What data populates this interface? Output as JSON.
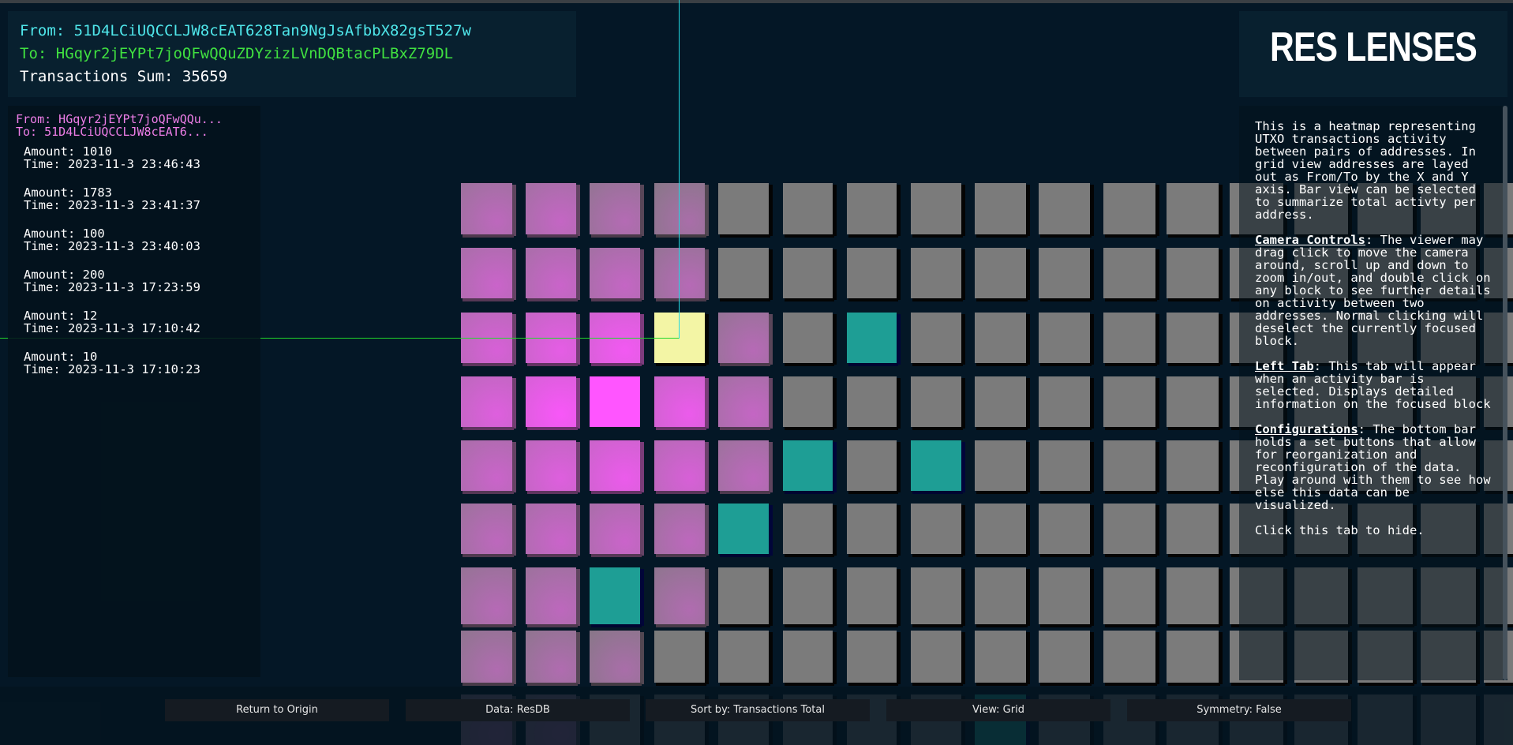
{
  "header": {
    "from_label": "From:",
    "from_address": "51D4LCiUQCCLJW8cEAT628Tan9NgJsAfbbX82gsT527w",
    "to_label": "To:",
    "to_address": "HGqyr2jEYPt7joQFwQQuZDYzizLVnDQBtacPLBxZ79DL",
    "sum_label": "Transactions Sum:",
    "sum_value": "35659"
  },
  "logo": {
    "text": "RES LENSES"
  },
  "left_tab": {
    "from_text": "From: HGqyr2jEYPt7joQFwQQu...",
    "to_text": "To: 51D4LCiUQCCLJW8cEAT6...",
    "transactions": [
      {
        "amount": "Amount: 1010",
        "time": "Time: 2023-11-3 23:46:43"
      },
      {
        "amount": "Amount: 1783",
        "time": "Time: 2023-11-3 23:41:37"
      },
      {
        "amount": "Amount: 100",
        "time": "Time: 2023-11-3 23:40:03"
      },
      {
        "amount": "Amount: 200",
        "time": "Time: 2023-11-3 17:23:59"
      },
      {
        "amount": "Amount: 12",
        "time": "Time: 2023-11-3 17:10:42"
      },
      {
        "amount": "Amount: 10",
        "time": "Time: 2023-11-3 17:10:23"
      }
    ]
  },
  "info": {
    "intro": "This is a heatmap representing UTXO transactions activity between pairs of addresses. In grid view addresses are layed out as From/To by the X and Y axis. Bar view can be selected to summarize total activty per address.",
    "camera_title": "Camera Controls",
    "camera_text": ": The viewer may drag click to move the camera around, scroll up and down to zoom in/out, and double click on any block to see further details on activity between two addresses. Normal clicking will deselect the currently focused block.",
    "lefttab_title": "Left Tab",
    "lefttab_text": ": This tab will appear when an activity bar is selected. Displays detailed information on the focused block",
    "config_title": "Configurations",
    "config_text": ": The bottom bar holds a set buttons that allow for reorganization and reconfiguration of the data. Play around with them to see how else this data can be visualized.",
    "hide_text": "Click this tab to hide."
  },
  "bottom_bar": {
    "return_label": "Return to Origin",
    "data_label": "Data: ResDB",
    "sort_label": "Sort by: Transactions Total",
    "view_label": "View: Grid",
    "symmetry_label": "Symmetry: False"
  },
  "colors": {
    "background": "#041726",
    "panel": "#08202f",
    "cyan_text": "#4fe6ea",
    "green_text": "#40e040",
    "pink_text": "#ee7ee8",
    "block_gray": "#7b7b7b",
    "block_teal": "#1e9e95",
    "block_magenta": "#ff55ff",
    "block_yellow": "#f3f5a5"
  }
}
